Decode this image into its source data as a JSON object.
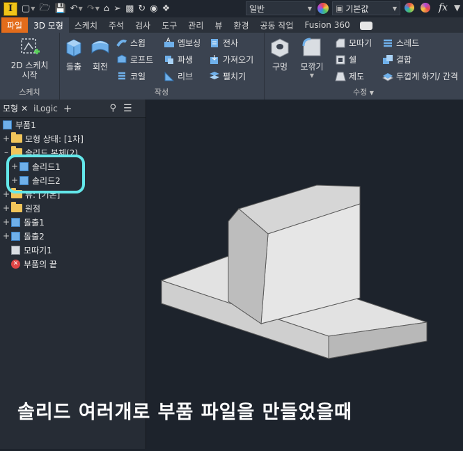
{
  "qat": {
    "combo_appearance": "일반",
    "combo_material": "기본값",
    "fx_label": "fx"
  },
  "tabs": [
    {
      "label": "파일"
    },
    {
      "label": "3D 모형"
    },
    {
      "label": "스케치"
    },
    {
      "label": "주석"
    },
    {
      "label": "검사"
    },
    {
      "label": "도구"
    },
    {
      "label": "관리"
    },
    {
      "label": "뷰"
    },
    {
      "label": "환경"
    },
    {
      "label": "공동 작업"
    },
    {
      "label": "Fusion 360"
    }
  ],
  "ribbon": {
    "sketch": {
      "button": "2D 스케치\n시작",
      "button_line1": "2D 스케치",
      "button_line2": "시작",
      "group_label": "스케치"
    },
    "create": {
      "extrude": "돌출",
      "revolve": "회전",
      "sweep": "스윕",
      "loft": "로프트",
      "coil": "코일",
      "emboss": "엠보싱",
      "derive": "파생",
      "rib": "리브",
      "decal": "전사",
      "import": "가져오기",
      "unfold": "펼치기",
      "group_label": "작성"
    },
    "modify": {
      "hole": "구멍",
      "fillet": "모깎기",
      "chamfer": "모따기",
      "shell": "쉘",
      "draft": "제도",
      "thread": "스레드",
      "combine": "결합",
      "thicken": "두껍게 하기/ 간격",
      "group_label": "수정"
    }
  },
  "panel": {
    "tab_model": "모형",
    "tab_ilogic": "iLogic",
    "tree": [
      {
        "label": "부품1"
      },
      {
        "label": "모형 상태: [1차]"
      },
      {
        "label": "솔리드 본체(2)"
      },
      {
        "label": "솔리드1"
      },
      {
        "label": "솔리드2"
      },
      {
        "label": "뷰: [기본]"
      },
      {
        "label": "원점"
      },
      {
        "label": "돌출1"
      },
      {
        "label": "돌출2"
      },
      {
        "label": "모따기1"
      },
      {
        "label": "부품의 끝"
      }
    ]
  },
  "caption": "솔리드 여러개로 부품 파일을 만들었을때",
  "colors": {
    "file_tab": "#e36c1b",
    "highlight": "#63e7ea",
    "viewport_bg": "#1d232c"
  }
}
